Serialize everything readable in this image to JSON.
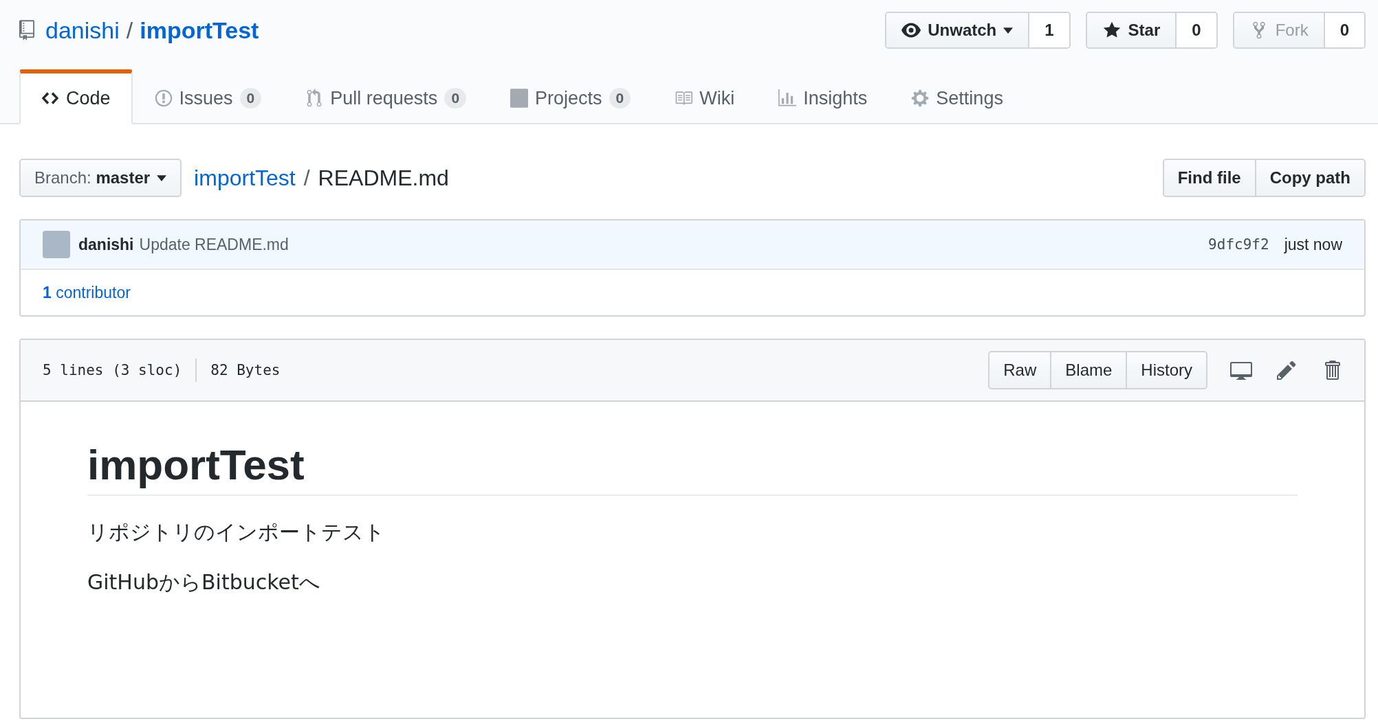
{
  "repo": {
    "owner": "danishi",
    "separator": "/",
    "name": "importTest"
  },
  "actions": [
    {
      "kind": "watch",
      "label": "Unwatch",
      "count": "1",
      "disabled": false
    },
    {
      "kind": "star",
      "label": "Star",
      "count": "0",
      "disabled": false
    },
    {
      "kind": "fork",
      "label": "Fork",
      "count": "0",
      "disabled": true
    }
  ],
  "tabs": [
    {
      "kind": "code",
      "label": "Code",
      "selected": true
    },
    {
      "kind": "issues",
      "label": "Issues",
      "counter": "0",
      "selected": false
    },
    {
      "kind": "pulls",
      "label": "Pull requests",
      "counter": "0",
      "selected": false
    },
    {
      "kind": "projects",
      "label": "Projects",
      "counter": "0",
      "selected": false
    },
    {
      "kind": "wiki",
      "label": "Wiki",
      "selected": false
    },
    {
      "kind": "insights",
      "label": "Insights",
      "selected": false
    },
    {
      "kind": "settings",
      "label": "Settings",
      "selected": false
    }
  ],
  "branch": {
    "prefix": "Branch:",
    "name": "master"
  },
  "breadcrumb": {
    "repo": "importTest",
    "separator": "/",
    "file": "README.md"
  },
  "file_buttons": [
    "Find file",
    "Copy path"
  ],
  "commit": {
    "author": "danishi",
    "message": "Update README.md",
    "sha": "9dfc9f2",
    "time": "just now"
  },
  "contributors": {
    "count": "1",
    "label": "contributor"
  },
  "file_info": {
    "lines": "5 lines (3 sloc)",
    "size": "82 Bytes"
  },
  "view_buttons": [
    "Raw",
    "Blame",
    "History"
  ],
  "readme": {
    "heading": "importTest",
    "paragraphs": [
      "リポジトリのインポートテスト",
      "GitHubからBitbucketへ"
    ]
  }
}
